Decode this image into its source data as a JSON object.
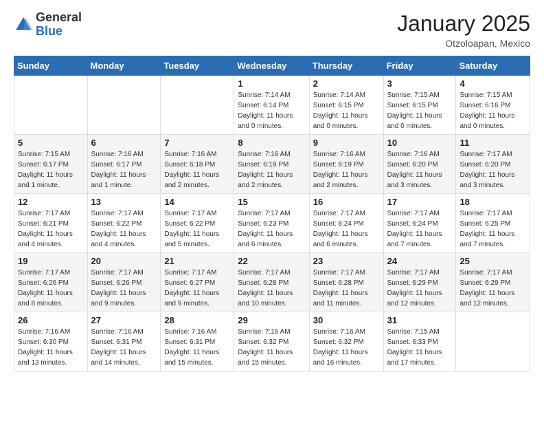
{
  "logo": {
    "general": "General",
    "blue": "Blue"
  },
  "header": {
    "month": "January 2025",
    "location": "Otzoloapan, Mexico"
  },
  "days_of_week": [
    "Sunday",
    "Monday",
    "Tuesday",
    "Wednesday",
    "Thursday",
    "Friday",
    "Saturday"
  ],
  "weeks": [
    [
      {
        "day": "",
        "info": ""
      },
      {
        "day": "",
        "info": ""
      },
      {
        "day": "",
        "info": ""
      },
      {
        "day": "1",
        "info": "Sunrise: 7:14 AM\nSunset: 6:14 PM\nDaylight: 11 hours\nand 0 minutes."
      },
      {
        "day": "2",
        "info": "Sunrise: 7:14 AM\nSunset: 6:15 PM\nDaylight: 11 hours\nand 0 minutes."
      },
      {
        "day": "3",
        "info": "Sunrise: 7:15 AM\nSunset: 6:15 PM\nDaylight: 11 hours\nand 0 minutes."
      },
      {
        "day": "4",
        "info": "Sunrise: 7:15 AM\nSunset: 6:16 PM\nDaylight: 11 hours\nand 0 minutes."
      }
    ],
    [
      {
        "day": "5",
        "info": "Sunrise: 7:15 AM\nSunset: 6:17 PM\nDaylight: 11 hours\nand 1 minute."
      },
      {
        "day": "6",
        "info": "Sunrise: 7:16 AM\nSunset: 6:17 PM\nDaylight: 11 hours\nand 1 minute."
      },
      {
        "day": "7",
        "info": "Sunrise: 7:16 AM\nSunset: 6:18 PM\nDaylight: 11 hours\nand 2 minutes."
      },
      {
        "day": "8",
        "info": "Sunrise: 7:16 AM\nSunset: 6:19 PM\nDaylight: 11 hours\nand 2 minutes."
      },
      {
        "day": "9",
        "info": "Sunrise: 7:16 AM\nSunset: 6:19 PM\nDaylight: 11 hours\nand 2 minutes."
      },
      {
        "day": "10",
        "info": "Sunrise: 7:16 AM\nSunset: 6:20 PM\nDaylight: 11 hours\nand 3 minutes."
      },
      {
        "day": "11",
        "info": "Sunrise: 7:17 AM\nSunset: 6:20 PM\nDaylight: 11 hours\nand 3 minutes."
      }
    ],
    [
      {
        "day": "12",
        "info": "Sunrise: 7:17 AM\nSunset: 6:21 PM\nDaylight: 11 hours\nand 4 minutes."
      },
      {
        "day": "13",
        "info": "Sunrise: 7:17 AM\nSunset: 6:22 PM\nDaylight: 11 hours\nand 4 minutes."
      },
      {
        "day": "14",
        "info": "Sunrise: 7:17 AM\nSunset: 6:22 PM\nDaylight: 11 hours\nand 5 minutes."
      },
      {
        "day": "15",
        "info": "Sunrise: 7:17 AM\nSunset: 6:23 PM\nDaylight: 11 hours\nand 6 minutes."
      },
      {
        "day": "16",
        "info": "Sunrise: 7:17 AM\nSunset: 6:24 PM\nDaylight: 11 hours\nand 6 minutes."
      },
      {
        "day": "17",
        "info": "Sunrise: 7:17 AM\nSunset: 6:24 PM\nDaylight: 11 hours\nand 7 minutes."
      },
      {
        "day": "18",
        "info": "Sunrise: 7:17 AM\nSunset: 6:25 PM\nDaylight: 11 hours\nand 7 minutes."
      }
    ],
    [
      {
        "day": "19",
        "info": "Sunrise: 7:17 AM\nSunset: 6:26 PM\nDaylight: 11 hours\nand 8 minutes."
      },
      {
        "day": "20",
        "info": "Sunrise: 7:17 AM\nSunset: 6:26 PM\nDaylight: 11 hours\nand 9 minutes."
      },
      {
        "day": "21",
        "info": "Sunrise: 7:17 AM\nSunset: 6:27 PM\nDaylight: 11 hours\nand 9 minutes."
      },
      {
        "day": "22",
        "info": "Sunrise: 7:17 AM\nSunset: 6:28 PM\nDaylight: 11 hours\nand 10 minutes."
      },
      {
        "day": "23",
        "info": "Sunrise: 7:17 AM\nSunset: 6:28 PM\nDaylight: 11 hours\nand 11 minutes."
      },
      {
        "day": "24",
        "info": "Sunrise: 7:17 AM\nSunset: 6:29 PM\nDaylight: 11 hours\nand 12 minutes."
      },
      {
        "day": "25",
        "info": "Sunrise: 7:17 AM\nSunset: 6:29 PM\nDaylight: 11 hours\nand 12 minutes."
      }
    ],
    [
      {
        "day": "26",
        "info": "Sunrise: 7:16 AM\nSunset: 6:30 PM\nDaylight: 11 hours\nand 13 minutes."
      },
      {
        "day": "27",
        "info": "Sunrise: 7:16 AM\nSunset: 6:31 PM\nDaylight: 11 hours\nand 14 minutes."
      },
      {
        "day": "28",
        "info": "Sunrise: 7:16 AM\nSunset: 6:31 PM\nDaylight: 11 hours\nand 15 minutes."
      },
      {
        "day": "29",
        "info": "Sunrise: 7:16 AM\nSunset: 6:32 PM\nDaylight: 11 hours\nand 15 minutes."
      },
      {
        "day": "30",
        "info": "Sunrise: 7:16 AM\nSunset: 6:32 PM\nDaylight: 11 hours\nand 16 minutes."
      },
      {
        "day": "31",
        "info": "Sunrise: 7:15 AM\nSunset: 6:33 PM\nDaylight: 11 hours\nand 17 minutes."
      },
      {
        "day": "",
        "info": ""
      }
    ]
  ]
}
